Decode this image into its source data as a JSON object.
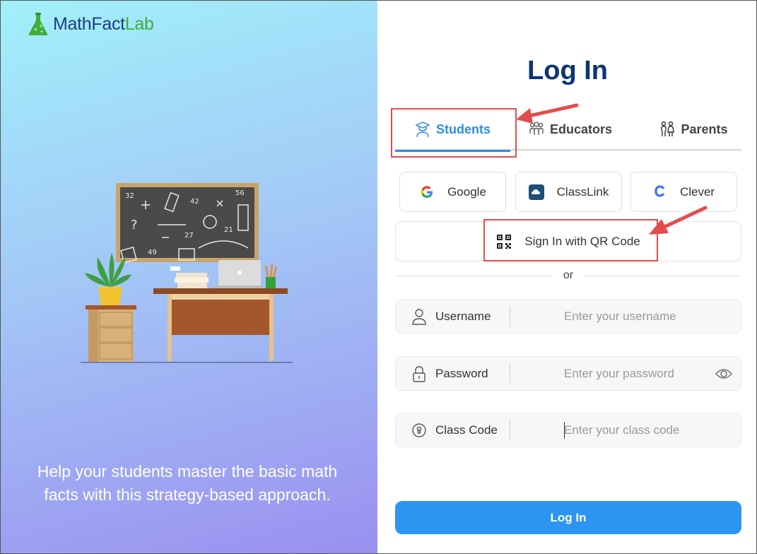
{
  "brand": {
    "name_part1": "MathFact",
    "name_part2": "Lab"
  },
  "tagline": "Help your students master the basic math facts with this strategy-based approach.",
  "login": {
    "title": "Log In",
    "tabs": [
      {
        "label": "Students",
        "icon": "student-icon",
        "active": true
      },
      {
        "label": "Educators",
        "icon": "educators-icon",
        "active": false
      },
      {
        "label": "Parents",
        "icon": "parents-icon",
        "active": false
      }
    ],
    "sso": [
      {
        "label": "Google",
        "icon": "google-icon"
      },
      {
        "label": "ClassLink",
        "icon": "classlink-icon"
      },
      {
        "label": "Clever",
        "icon": "clever-icon"
      }
    ],
    "qr_label": "Sign In with QR Code",
    "or_text": "or",
    "fields": {
      "username": {
        "label": "Username",
        "placeholder": "Enter your username"
      },
      "password": {
        "label": "Password",
        "placeholder": "Enter your password"
      },
      "class_code": {
        "label": "Class Code",
        "placeholder": "Enter your class code"
      }
    },
    "submit_label": "Log In"
  },
  "colors": {
    "primary": "#2c95f2",
    "title": "#0d3573",
    "annotation": "#e34c4c",
    "brand_green": "#3fae3a"
  }
}
